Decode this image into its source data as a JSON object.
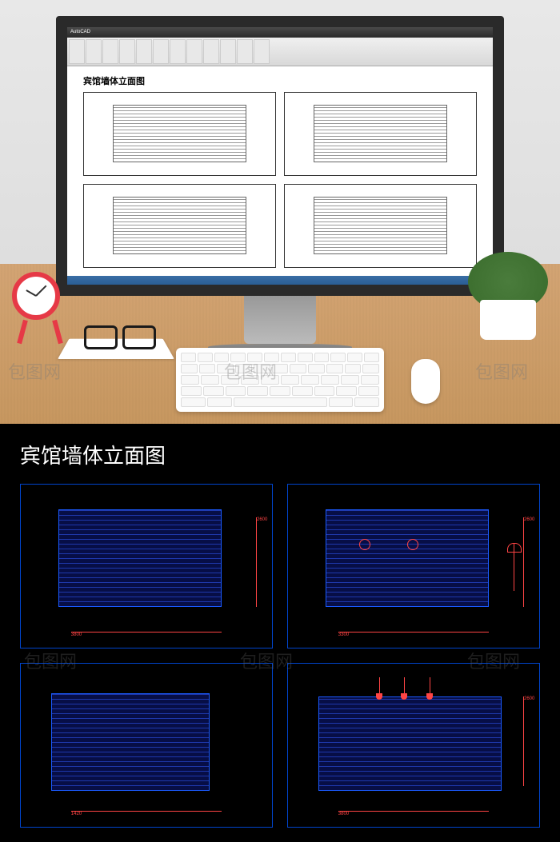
{
  "top": {
    "app_title": "AutoCAD",
    "drawing_title": "宾馆墙体立面图",
    "watermark": "包图网"
  },
  "bottom": {
    "drawing_title": "宾馆墙体立面图",
    "watermark": "包图网",
    "dimensions": {
      "p1_w": "3800",
      "p1_h": "2600",
      "p2_w": "3300",
      "p2_h": "2600",
      "p3_w": "1420",
      "p4_w": "3800",
      "p4_h": "2600"
    }
  }
}
